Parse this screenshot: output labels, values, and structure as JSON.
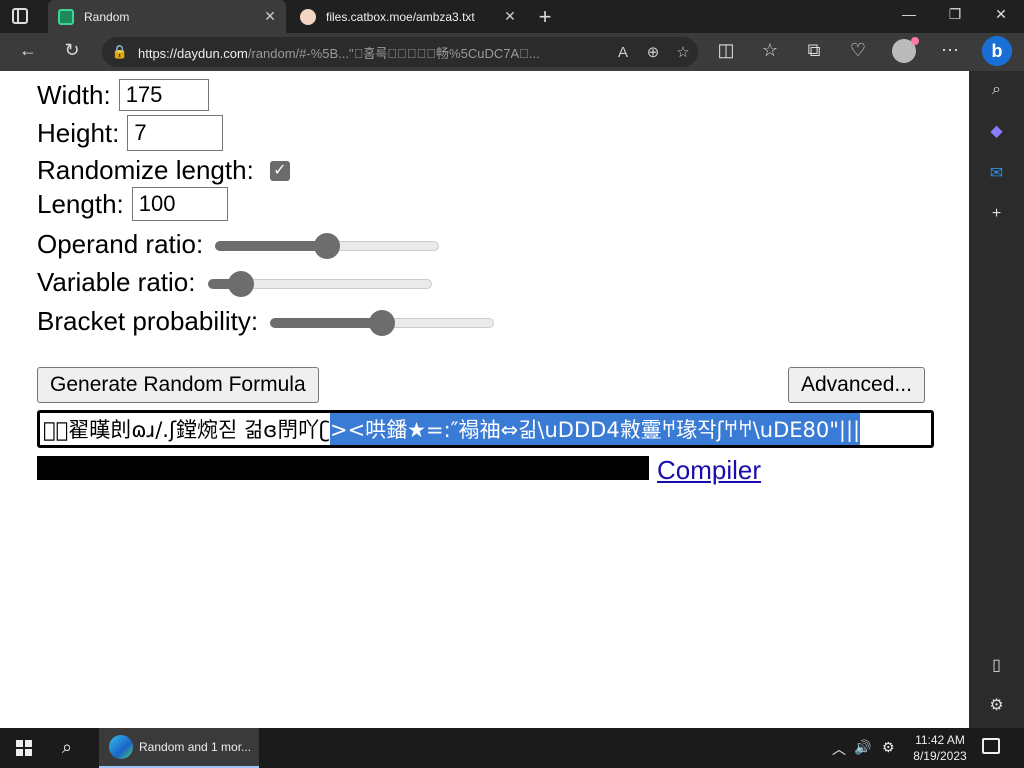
{
  "browser": {
    "tabs": [
      {
        "title": "Random",
        "active": true
      },
      {
        "title": "files.catbox.moe/ambza3.txt",
        "active": false
      }
    ],
    "url_host": "https://daydun.com",
    "url_path": "/random/#-%5B...\"\u0000홈륵\u0000\u0000\u0000\u0000\u0000畅%5CuDC7A\u0000...",
    "icons": [
      "back-icon",
      "refresh-icon",
      "lock-icon",
      "read-aloud-icon",
      "zoom-icon",
      "favorite-star-icon",
      "split-screen-icon",
      "favorites-icon",
      "collections-icon",
      "performance-icon",
      "profile-avatar",
      "more-icon",
      "bing-copilot-icon"
    ]
  },
  "sidebar": {
    "icons": [
      "search-icon",
      "copilot-icon",
      "outlook-icon",
      "add-icon",
      "hide-sidebar-icon",
      "settings-icon"
    ]
  },
  "form": {
    "width_label": "Width:",
    "width_value": "175",
    "height_label": "Height:",
    "height_value": "7",
    "randomize_label": "Randomize length:",
    "randomize_checked": true,
    "length_label": "Length:",
    "length_value": "100",
    "operand_label": "Operand ratio:",
    "operand_value": 0.5,
    "variable_label": "Variable ratio:",
    "variable_value": 0.15,
    "bracket_label": "Bracket probability:",
    "bracket_value": 0.5,
    "generate_button": "Generate Random Formula",
    "advanced_button": "Advanced...",
    "formula_plain": "重ᷫ翟暵剆ɷɹ/.ʃ鏜焥짇 걺ɞ閅吖ʗ",
    "formula_selected": "><哄鐇★=:″褟䄂⇔긺\\uDDD4敹霻𐀀瑑작ʃ𐀀𐀀\\uDE80\"|||",
    "link_label": "Compiler"
  },
  "taskbar": {
    "app_label": "Random and 1 mor...",
    "time": "11:42 AM",
    "date": "8/19/2023"
  },
  "colors": {
    "selection": "#3a7bd5",
    "link": "#1a0dab",
    "chrome_dark": "#202020"
  }
}
